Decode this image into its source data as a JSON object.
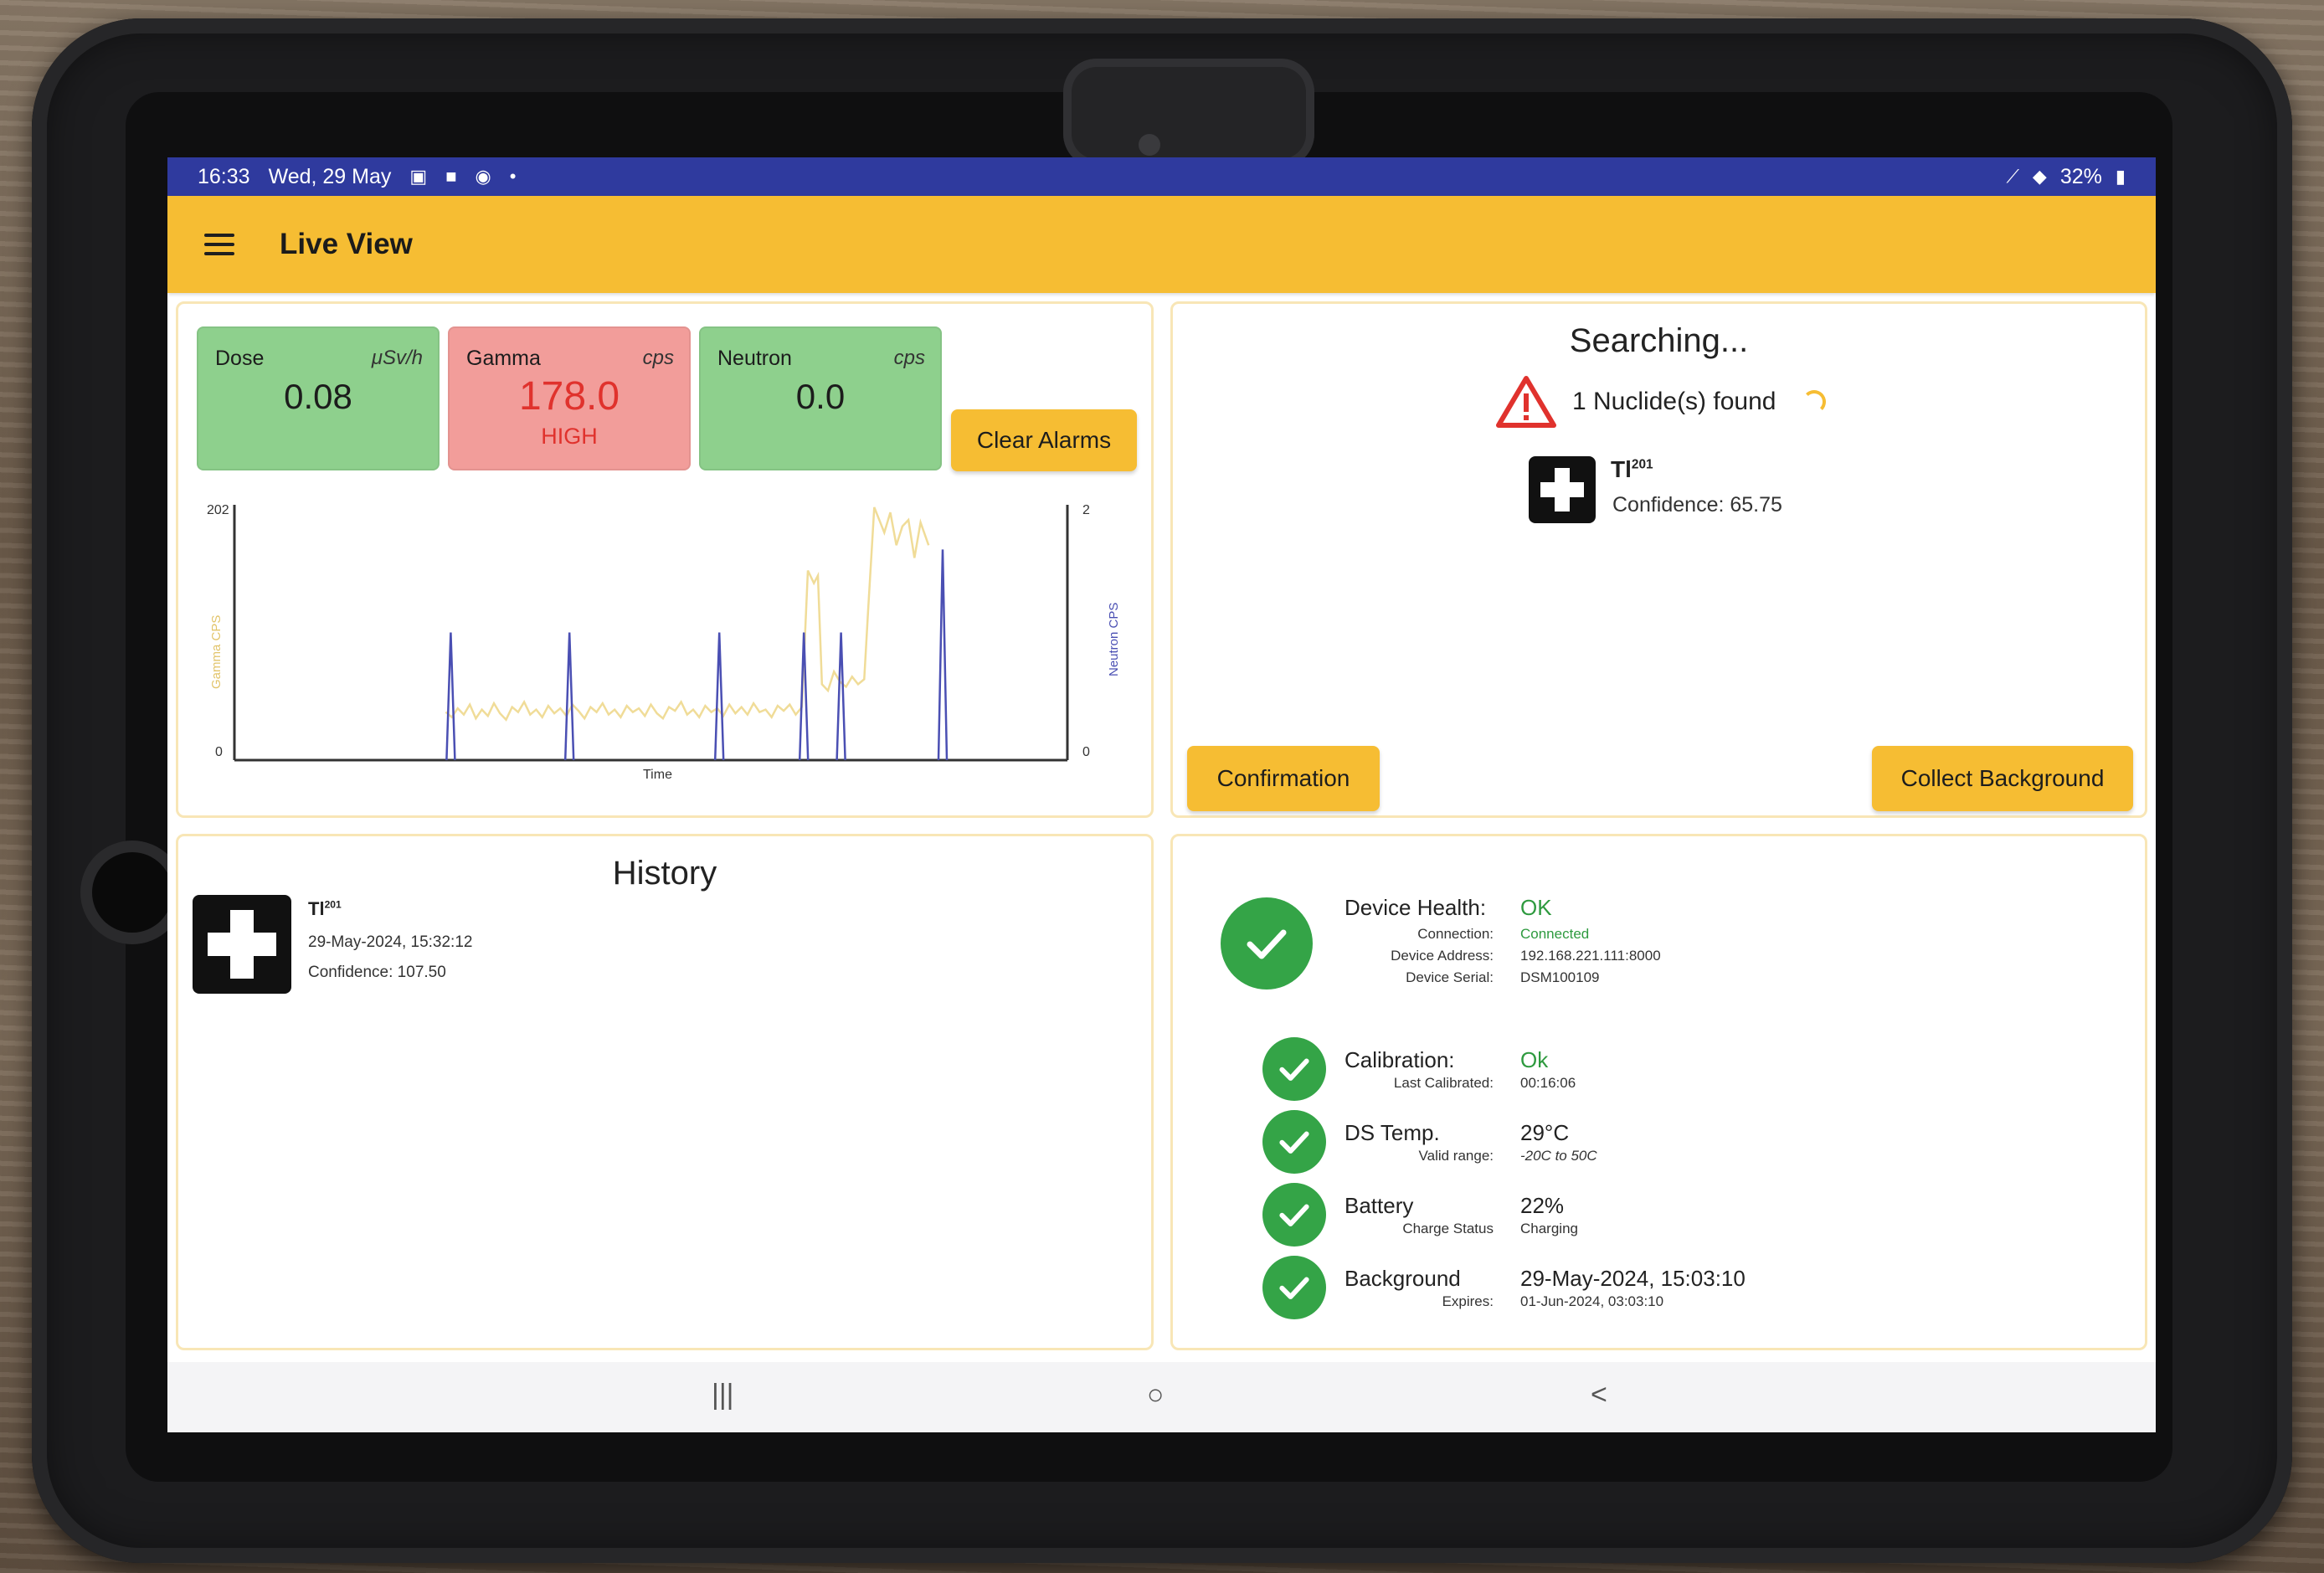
{
  "status_bar": {
    "time": "16:33",
    "date": "Wed, 29 May",
    "battery": "32%",
    "icons": [
      "gallery-icon",
      "record-icon",
      "sync-icon",
      "dot-icon",
      "signal-icon",
      "wifi-icon",
      "battery-icon"
    ]
  },
  "app_bar": {
    "title": "Live View",
    "menu_icon": "hamburger-icon"
  },
  "live": {
    "tiles": [
      {
        "label": "Dose",
        "unit": "μSv/h",
        "value": "0.08",
        "status": "",
        "color": "#8ed08d"
      },
      {
        "label": "Gamma",
        "unit": "cps",
        "value": "178.0",
        "status": "HIGH",
        "color": "#f29d9a"
      },
      {
        "label": "Neutron",
        "unit": "cps",
        "value": "0.0",
        "status": "",
        "color": "#8ed08d"
      }
    ],
    "clear_button": "Clear Alarms"
  },
  "chart_data": {
    "type": "line",
    "xlabel": "Time",
    "ylabel_left": "Gamma CPS",
    "ylabel_right": "Neutron CPS",
    "y_left_range": [
      0,
      202
    ],
    "y_right_range": [
      0,
      2
    ],
    "y_left_ticks": [
      "202",
      "0"
    ],
    "y_right_ticks": [
      "2",
      "0"
    ],
    "grid": false,
    "series": [
      {
        "name": "Gamma CPS",
        "color": "#f0dc98",
        "x": [
          0,
          12,
          24,
          36,
          48,
          60,
          72,
          84,
          96,
          108,
          120,
          132,
          144,
          156,
          168,
          180,
          192,
          204,
          216,
          228,
          240,
          252,
          264,
          276,
          288,
          300,
          312,
          324,
          336,
          348,
          360,
          372,
          384,
          396,
          408,
          420,
          432,
          444,
          456,
          468,
          480,
          492,
          504,
          516,
          528,
          540,
          552,
          564,
          576,
          588,
          600,
          612,
          624,
          636,
          648,
          660,
          672,
          684,
          696,
          708,
          720,
          732,
          744,
          756,
          768,
          780,
          792,
          804,
          816,
          828
        ],
        "values": [
          null,
          null,
          null,
          null,
          null,
          null,
          null,
          null,
          null,
          null,
          null,
          null,
          null,
          null,
          null,
          null,
          null,
          null,
          null,
          null,
          null,
          null,
          null,
          null,
          null,
          null,
          null,
          null,
          null,
          null,
          null,
          null,
          null,
          null,
          null,
          null,
          null,
          null,
          null,
          null,
          null,
          null,
          null,
          null,
          null,
          null,
          null,
          null,
          null,
          null,
          null,
          null,
          null,
          null,
          null,
          null,
          null,
          null,
          null,
          null,
          null,
          null,
          null,
          null,
          null,
          null,
          null,
          null,
          null,
          null
        ]
      },
      {
        "name": "Neutron CPS",
        "color": "#4a4fb3",
        "spikes_x": [
          215,
          333,
          482,
          566,
          603,
          704
        ],
        "spike_value": 1
      }
    ],
    "gamma_points": [
      [
        210,
        38
      ],
      [
        216,
        34
      ],
      [
        222,
        41
      ],
      [
        228,
        36
      ],
      [
        234,
        44
      ],
      [
        240,
        33
      ],
      [
        246,
        40
      ],
      [
        252,
        35
      ],
      [
        258,
        45
      ],
      [
        264,
        37
      ],
      [
        270,
        32
      ],
      [
        276,
        42
      ],
      [
        282,
        38
      ],
      [
        288,
        46
      ],
      [
        294,
        36
      ],
      [
        300,
        40
      ],
      [
        306,
        34
      ],
      [
        312,
        43
      ],
      [
        318,
        37
      ],
      [
        324,
        41
      ],
      [
        330,
        35
      ],
      [
        336,
        44
      ],
      [
        342,
        39
      ],
      [
        348,
        33
      ],
      [
        354,
        42
      ],
      [
        360,
        38
      ],
      [
        366,
        45
      ],
      [
        372,
        36
      ],
      [
        378,
        40
      ],
      [
        384,
        34
      ],
      [
        390,
        43
      ],
      [
        396,
        38
      ],
      [
        402,
        41
      ],
      [
        408,
        35
      ],
      [
        414,
        44
      ],
      [
        420,
        37
      ],
      [
        426,
        33
      ],
      [
        432,
        42
      ],
      [
        438,
        39
      ],
      [
        444,
        46
      ],
      [
        450,
        36
      ],
      [
        456,
        40
      ],
      [
        462,
        34
      ],
      [
        468,
        43
      ],
      [
        474,
        38
      ],
      [
        480,
        41
      ],
      [
        486,
        35
      ],
      [
        492,
        44
      ],
      [
        498,
        37
      ],
      [
        504,
        42
      ],
      [
        510,
        36
      ],
      [
        516,
        45
      ],
      [
        522,
        38
      ],
      [
        528,
        40
      ],
      [
        534,
        34
      ],
      [
        540,
        43
      ],
      [
        546,
        39
      ],
      [
        552,
        44
      ],
      [
        558,
        36
      ],
      [
        564,
        42
      ],
      [
        570,
        150
      ],
      [
        576,
        140
      ],
      [
        580,
        146
      ],
      [
        584,
        60
      ],
      [
        590,
        55
      ],
      [
        596,
        70
      ],
      [
        602,
        62
      ],
      [
        608,
        58
      ],
      [
        614,
        66
      ],
      [
        620,
        60
      ],
      [
        626,
        64
      ],
      [
        630,
        120
      ],
      [
        636,
        200
      ],
      [
        640,
        192
      ],
      [
        646,
        180
      ],
      [
        652,
        196
      ],
      [
        658,
        170
      ],
      [
        664,
        185
      ],
      [
        670,
        190
      ],
      [
        676,
        160
      ],
      [
        682,
        188
      ],
      [
        690,
        170
      ]
    ]
  },
  "search": {
    "title": "Searching...",
    "found_text": "1 Nuclide(s) found",
    "nuclide_symbol": "Tl",
    "nuclide_mass": "201",
    "confidence": "Confidence: 65.75",
    "confirmation_button": "Confirmation",
    "collect_button": "Collect Background"
  },
  "history": {
    "title": "History",
    "items": [
      {
        "symbol": "Tl",
        "mass": "201",
        "date": "29-May-2024, 15:32:12",
        "confidence": "Confidence: 107.50"
      }
    ]
  },
  "health": {
    "device": {
      "label": "Device Health:",
      "value": "OK",
      "sub": [
        {
          "label": "Connection:",
          "value": "Connected"
        },
        {
          "label": "Device Address:",
          "value": "192.168.221.111:8000"
        },
        {
          "label": "Device Serial:",
          "value": "DSM100109"
        }
      ]
    },
    "calibration": {
      "label": "Calibration:",
      "value": "Ok",
      "sub_label": "Last Calibrated:",
      "sub_value": "00:16:06"
    },
    "ds_temp": {
      "label": "DS Temp.",
      "value": "29°C",
      "sub_label": "Valid range:",
      "sub_value": "-20C to 50C"
    },
    "battery": {
      "label": "Battery",
      "value": "22%",
      "sub_label": "Charge Status",
      "sub_value": "Charging"
    },
    "background": {
      "label": "Background",
      "value": "29-May-2024, 15:03:10",
      "sub_label": "Expires:",
      "sub_value": "01-Jun-2024, 03:03:10"
    }
  },
  "nav": {
    "recents": "|||",
    "home": "○",
    "back": "<"
  }
}
